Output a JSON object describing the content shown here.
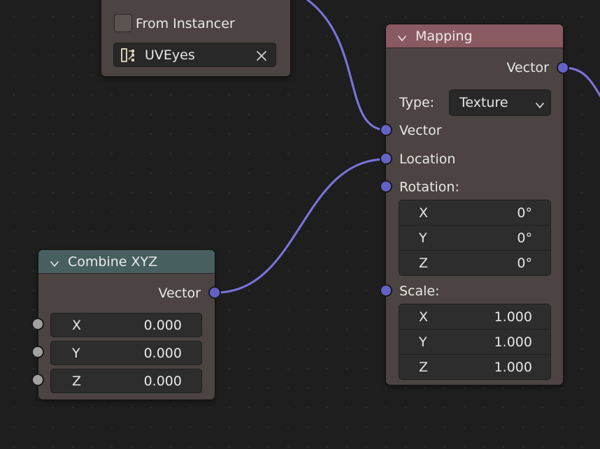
{
  "colors": {
    "background": "#1e1e1e",
    "node_body": "#4b4442",
    "mapping_header": "#8a5a63",
    "combine_header": "#47605f",
    "vector_socket": "#6363c7",
    "float_socket": "#a1a1a1",
    "link": "#7a72d8"
  },
  "texture_node": {
    "from_instancer_label": "From Instancer",
    "uv_map_value": "UVEyes",
    "uv_icon": "uv-map-icon",
    "clear_icon": "close-icon"
  },
  "mapping_node": {
    "title": "Mapping",
    "output_vector_label": "Vector",
    "type_label": "Type:",
    "type_value": "Texture",
    "input_vector_label": "Vector",
    "location_label": "Location",
    "rotation_label": "Rotation:",
    "rotation": [
      {
        "axis": "X",
        "value": "0°"
      },
      {
        "axis": "Y",
        "value": "0°"
      },
      {
        "axis": "Z",
        "value": "0°"
      }
    ],
    "scale_label": "Scale:",
    "scale": [
      {
        "axis": "X",
        "value": "1.000"
      },
      {
        "axis": "Y",
        "value": "1.000"
      },
      {
        "axis": "Z",
        "value": "1.000"
      }
    ]
  },
  "combine_node": {
    "title": "Combine XYZ",
    "output_vector_label": "Vector",
    "inputs": [
      {
        "axis": "X",
        "value": "0.000"
      },
      {
        "axis": "Y",
        "value": "0.000"
      },
      {
        "axis": "Z",
        "value": "0.000"
      }
    ]
  }
}
